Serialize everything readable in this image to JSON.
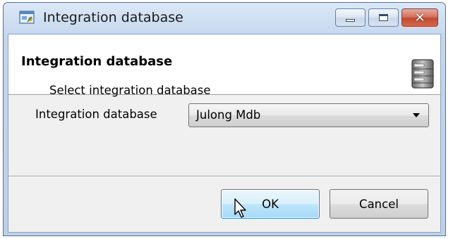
{
  "window": {
    "title": "Integration database",
    "app_icon": "window-app-icon",
    "buttons": {
      "minimize_icon": "minimize-icon",
      "maximize_icon": "maximize-icon",
      "close_glyph": "✕"
    }
  },
  "header": {
    "title": "Integration database",
    "subtitle": "Select integration database",
    "icon": "database-icon"
  },
  "form": {
    "label": "Integration database",
    "selected_value": "Julong Mdb"
  },
  "footer": {
    "ok_label": "OK",
    "cancel_label": "Cancel"
  },
  "colors": {
    "frame": "#c3d6ee",
    "close": "#c24a30",
    "ok_focus": "#3c7fb1"
  }
}
